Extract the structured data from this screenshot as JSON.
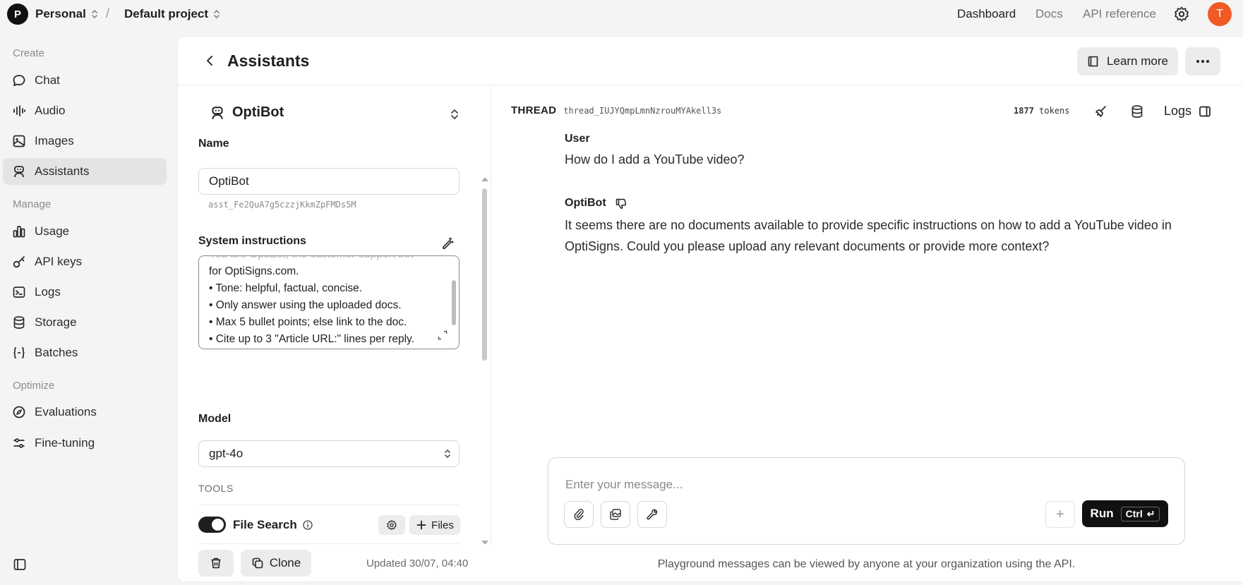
{
  "topbar": {
    "org_initial": "P",
    "org_name": "Personal",
    "separator": "/",
    "project_name": "Default project",
    "links": [
      "Dashboard",
      "Docs",
      "API reference"
    ],
    "user_initial": "T"
  },
  "sidebar": {
    "sections": [
      "Create",
      "Manage",
      "Optimize"
    ],
    "items": [
      {
        "label": "Chat",
        "icon": "chat-icon"
      },
      {
        "label": "Audio",
        "icon": "audio-icon"
      },
      {
        "label": "Images",
        "icon": "image-icon"
      },
      {
        "label": "Assistants",
        "icon": "assistant-icon",
        "active": true
      },
      {
        "label": "Usage",
        "icon": "chart-icon"
      },
      {
        "label": "API keys",
        "icon": "key-icon"
      },
      {
        "label": "Logs",
        "icon": "terminal-icon"
      },
      {
        "label": "Storage",
        "icon": "database-icon"
      },
      {
        "label": "Batches",
        "icon": "braces-icon"
      },
      {
        "label": "Evaluations",
        "icon": "compass-icon"
      },
      {
        "label": "Fine-tuning",
        "icon": "sliders-icon"
      }
    ]
  },
  "header": {
    "title": "Assistants",
    "learn_more": "Learn more"
  },
  "assistant": {
    "name_display": "OptiBot",
    "name_label": "Name",
    "name_value": "OptiBot",
    "id": "asst_Fe2QuA7g5czzjKkmZpFMDs5M",
    "instructions_label": "System instructions",
    "instructions_lines": [
      "You are OptiBot, the customer-support bot",
      "for OptiSigns.com.",
      "• Tone: helpful, factual, concise.",
      "• Only answer using the uploaded docs.",
      "• Max 5 bullet points; else link to the doc.",
      "• Cite up to 3 \"Article URL:\" lines per reply."
    ],
    "model_label": "Model",
    "model_value": "gpt-4o",
    "tools_label": "TOOLS",
    "file_search_label": "File Search",
    "file_search_enabled": true,
    "files_button": "Files",
    "clone_button": "Clone",
    "updated": "Updated 30/07, 04:40"
  },
  "thread": {
    "label": "THREAD",
    "id": "thread_IUJYQmpLmnNzrouMYAkell3s",
    "tokens_count": "1877",
    "tokens_unit": "tokens",
    "logs_label": "Logs",
    "messages": [
      {
        "role": "User",
        "text": "How do I add a YouTube video?"
      },
      {
        "role": "OptiBot",
        "text": "It seems there are no documents available to provide specific instructions on how to add a YouTube video in OptiSigns. Could you please upload any relevant documents or provide more context?"
      }
    ]
  },
  "composer": {
    "placeholder": "Enter your message...",
    "run_label": "Run",
    "shortcut": "Ctrl",
    "enter_glyph": "↵",
    "plus_glyph": "+",
    "disclaimer": "Playground messages can be viewed by anyone at your organization using the API."
  },
  "colors": {
    "accent_avatar": "#f05a24",
    "run_button": "#111111",
    "active_sidebar": "#e4e4e7"
  }
}
